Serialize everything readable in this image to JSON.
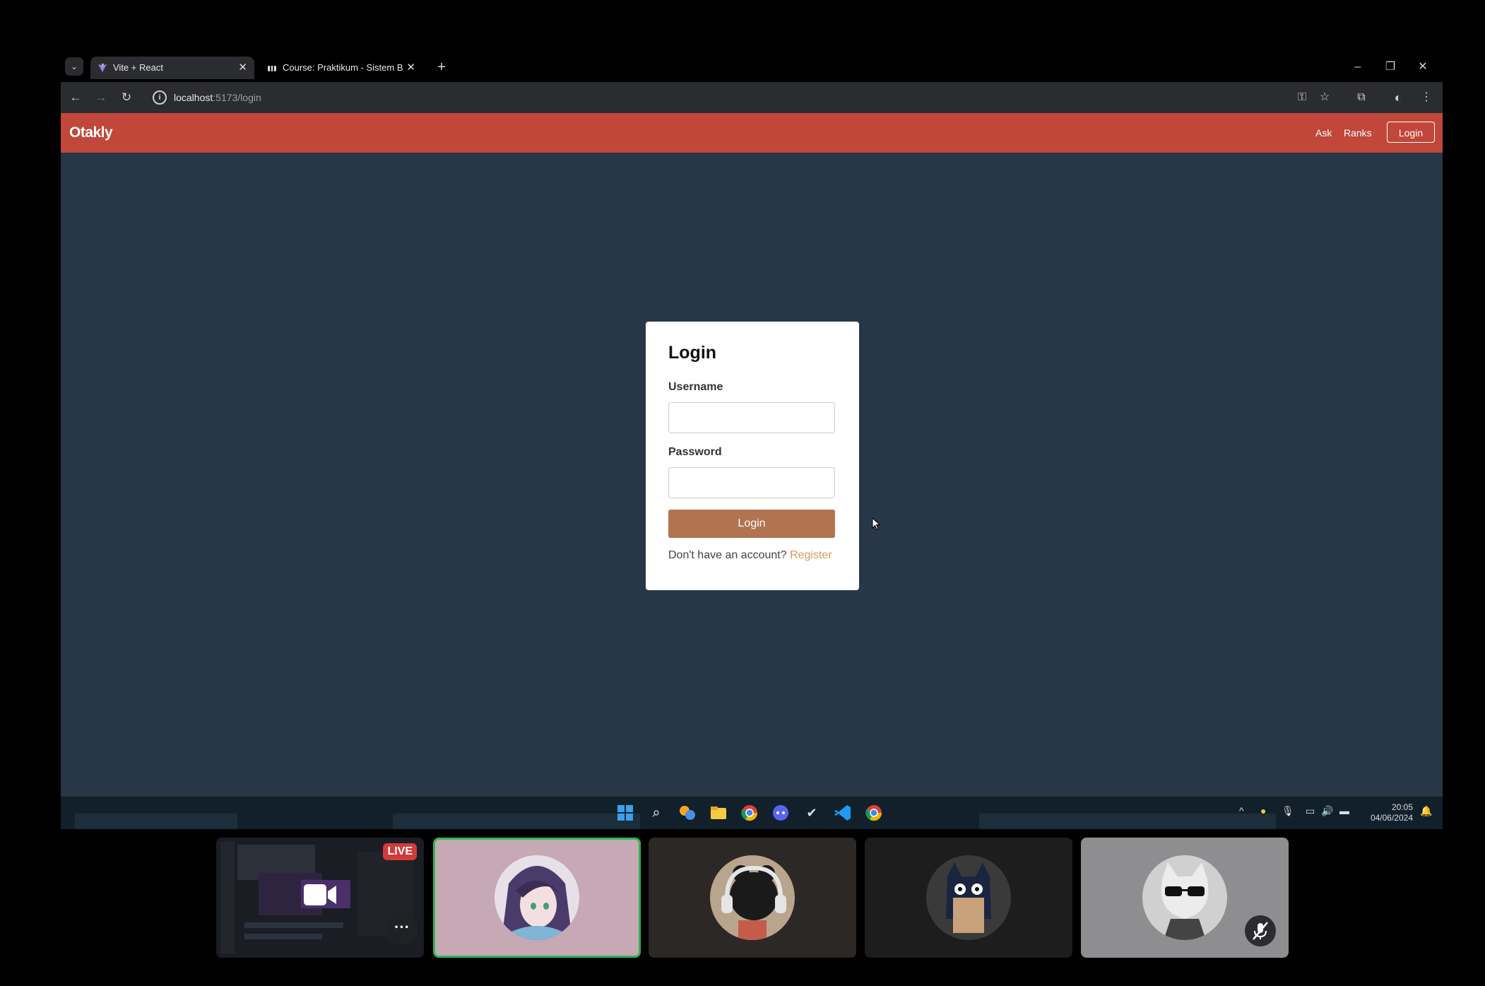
{
  "browser": {
    "tabs": [
      {
        "title": "Vite + React",
        "active": true
      },
      {
        "title": "Course: Praktikum - Sistem Bas",
        "active": false
      }
    ],
    "new_tab": "+",
    "url": {
      "host": "localhost",
      "path": ":5173/login"
    }
  },
  "app": {
    "brand": "Otakly",
    "nav": {
      "ask": "Ask",
      "ranks": "Ranks",
      "login": "Login"
    },
    "colors": {
      "navbar": "#c0473a",
      "page_bg": "#283747",
      "button": "#b27350",
      "link": "#d9985f"
    }
  },
  "login_form": {
    "heading": "Login",
    "username_label": "Username",
    "password_label": "Password",
    "username_value": "",
    "password_value": "",
    "submit_label": "Login",
    "no_account_text": "Don't have an account?",
    "register_link": "Register"
  },
  "taskbar": {
    "icons": [
      "windows-start-icon",
      "search-icon",
      "widgets-icon",
      "file-explorer-icon",
      "chrome-icon",
      "discord-icon",
      "steam-icon",
      "vscode-icon",
      "chrome-icon"
    ],
    "time": "20:05",
    "date": "04/06/2024"
  },
  "participants": {
    "live_label": "LIVE",
    "tiles": [
      {
        "type": "screen-share",
        "bg": "#1c1e22"
      },
      {
        "type": "avatar",
        "bg": "#c6a9b5",
        "speaking": true
      },
      {
        "type": "avatar",
        "bg": "#2c2825"
      },
      {
        "type": "avatar",
        "bg": "#1d1d1d"
      },
      {
        "type": "avatar",
        "bg": "#8e8e90",
        "muted": true
      }
    ]
  }
}
